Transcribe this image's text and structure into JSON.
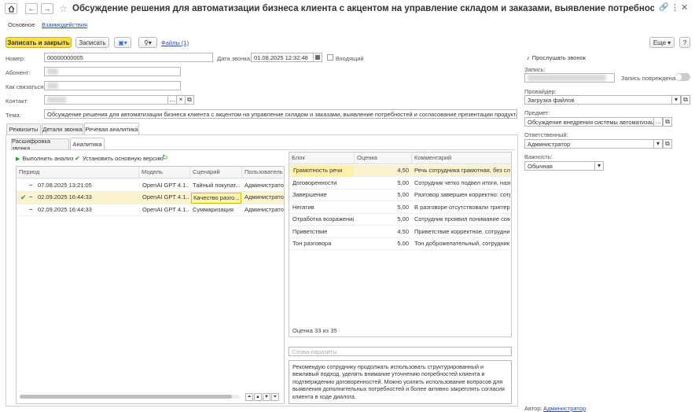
{
  "window": {
    "title": "Обсуждение решения для автоматизации бизнеса клиента с акцентом на управление складом и заказами, выявление потребностей и согласование презентат..."
  },
  "nav_tabs": {
    "main": "Основное",
    "interactions": "Взаимодействия"
  },
  "toolbar": {
    "save_close": "Записать и закрыть",
    "save": "Записать",
    "files": "Файлы (1)",
    "more": "Еще"
  },
  "fields": {
    "number_label": "Номер:",
    "number_value": "00000000005",
    "call_date_label": "Дата звонка:",
    "call_date_value": "01.08.2025 12:32:48",
    "incoming_label": "Входящий",
    "subscriber_label": "Абонент:",
    "contact_how_label": "Как связаться:",
    "contact_label": "Контакт:",
    "topic_label": "Тема:",
    "topic_value": "Обсуждение решения для автоматизации бизнеса клиента с акцентом на управление складом и заказами, выявление потребностей и согласование презентации продукта"
  },
  "tabs": {
    "requisites": "Реквизиты",
    "call_details": "Детали звонка",
    "speech_analytics": "Речевая аналитика"
  },
  "subtabs": {
    "transcript": "Расшифровка звонка",
    "analytics": "Аналитика"
  },
  "actions": {
    "run_analysis": "Выполнить анализ",
    "set_main_version": "Установить основную версию"
  },
  "left_grid": {
    "headers": [
      "Период",
      "Модель",
      "Сценарий",
      "Пользователь"
    ],
    "rows": [
      {
        "period": "07.08.2025 13:21:05",
        "model": "OpenAI GPT 4.1...",
        "scenario": "Тайный покупат...",
        "user": "Администратор",
        "selected": false,
        "checked": false
      },
      {
        "period": "02.09.2025 16:44:33",
        "model": "OpenAI GPT 4.1...",
        "scenario": "Качество разго...",
        "user": "Администратор",
        "selected": true,
        "checked": true
      },
      {
        "period": "02.09.2025 16:44:33",
        "model": "OpenAI GPT 4.1...",
        "scenario": "Суммаризация",
        "user": "Администратор",
        "selected": false,
        "checked": false
      }
    ]
  },
  "right_grid": {
    "headers": [
      "Блок",
      "Оценка",
      "Комментарий"
    ],
    "rows": [
      {
        "block": "Грамотность речи",
        "score": "4,50",
        "comment": "Речь сотрудника грамотная, без слов-..."
      },
      {
        "block": "Договоренности",
        "score": "5,00",
        "comment": "Сотрудник четко подвел итоги, назнач"
      },
      {
        "block": "Завершение",
        "score": "5,00",
        "comment": "Разговор завершен корректно: сотруд"
      },
      {
        "block": "Негатив",
        "score": "5,00",
        "comment": "В разговоре отсутствовали триггерны"
      },
      {
        "block": "Отработка возражений",
        "score": "5,00",
        "comment": "Сотрудник проявил понимание сомне"
      },
      {
        "block": "Приветствие",
        "score": "4,50",
        "comment": "Приветствие корректное, сотрудник пр"
      },
      {
        "block": "Тон разговора",
        "score": "5,00",
        "comment": "Тон доброжелательный, сотрудник пр"
      }
    ],
    "footer": "Оценка 33 из 35"
  },
  "parasites_placeholder": "Слова-паразиты",
  "recommendation": "Рекомендую сотруднику продолжать использовать структурированный и вежливый подход, уделять внимание уточнению потребностей клиента и подтверждению договоренностей. Можно усилить использование вопросов для выявления дополнительных потребностей и более активно закреплять согласия клиента в ходе диалога.",
  "right_panel": {
    "listen": "Прослушать звонок",
    "record_label": "Запись:",
    "record_damaged_label": "Запись повреждена:",
    "provider_label": "Провайдер:",
    "provider_value": "Загрузка файлов",
    "subject_label": "Предмет:",
    "subject_value": "Обсуждение внедрения системы автоматизации у...",
    "responsible_label": "Ответственный:",
    "responsible_value": "Администратор",
    "importance_label": "Важность:",
    "importance_value": "Обычная",
    "author_label": "Автор:",
    "author_value": "Администратор"
  },
  "colors": {
    "accent_yellow": "#f9e14a",
    "selected_row": "#fbf3cf",
    "link_blue": "#2a4ea0",
    "green": "#2e9a2e"
  }
}
